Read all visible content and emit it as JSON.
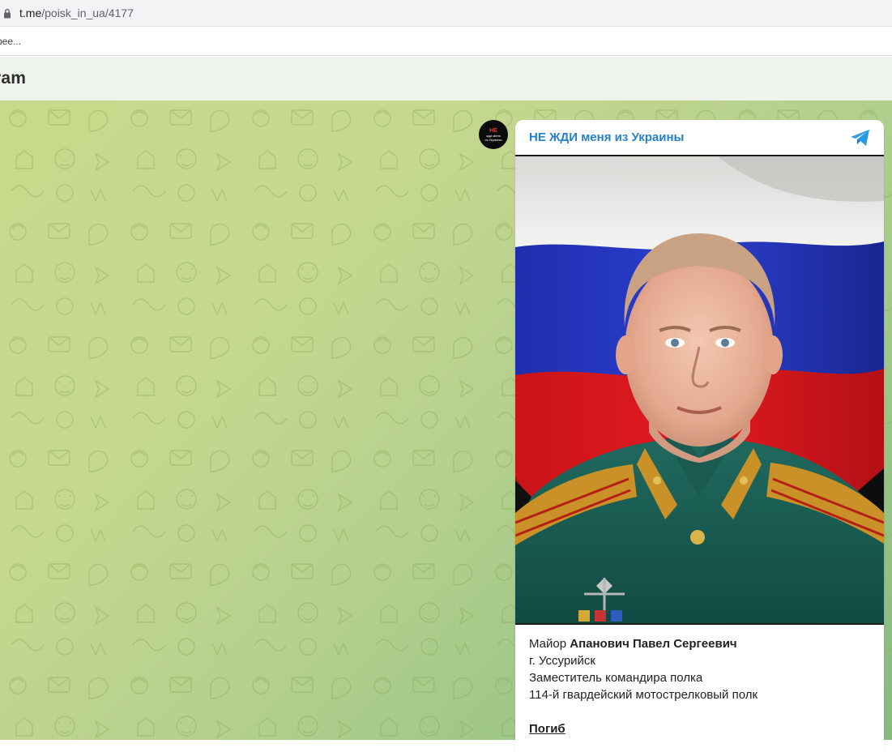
{
  "browser": {
    "url_host": "t.me",
    "url_path": "/poisk_in_ua/4177",
    "bookmark_label": "рее..."
  },
  "telegram_header": {
    "title": "ram"
  },
  "channel": {
    "name": "НЕ ЖДИ меня из Украины",
    "avatar_line1": "НЕ",
    "avatar_line2": "жди меня",
    "avatar_line3": "из Украины",
    "accent_color": "#2481cc"
  },
  "post": {
    "rank": "Майор",
    "full_name": "Апанович Павел Сергеевич",
    "city": "г. Уссурийск",
    "position": "Заместитель командира полка",
    "unit": "114-й гвардейский мотострелковый полк",
    "status": "Погиб"
  },
  "icons": {
    "lock": "lock-icon",
    "telegram": "telegram-plane-icon"
  }
}
